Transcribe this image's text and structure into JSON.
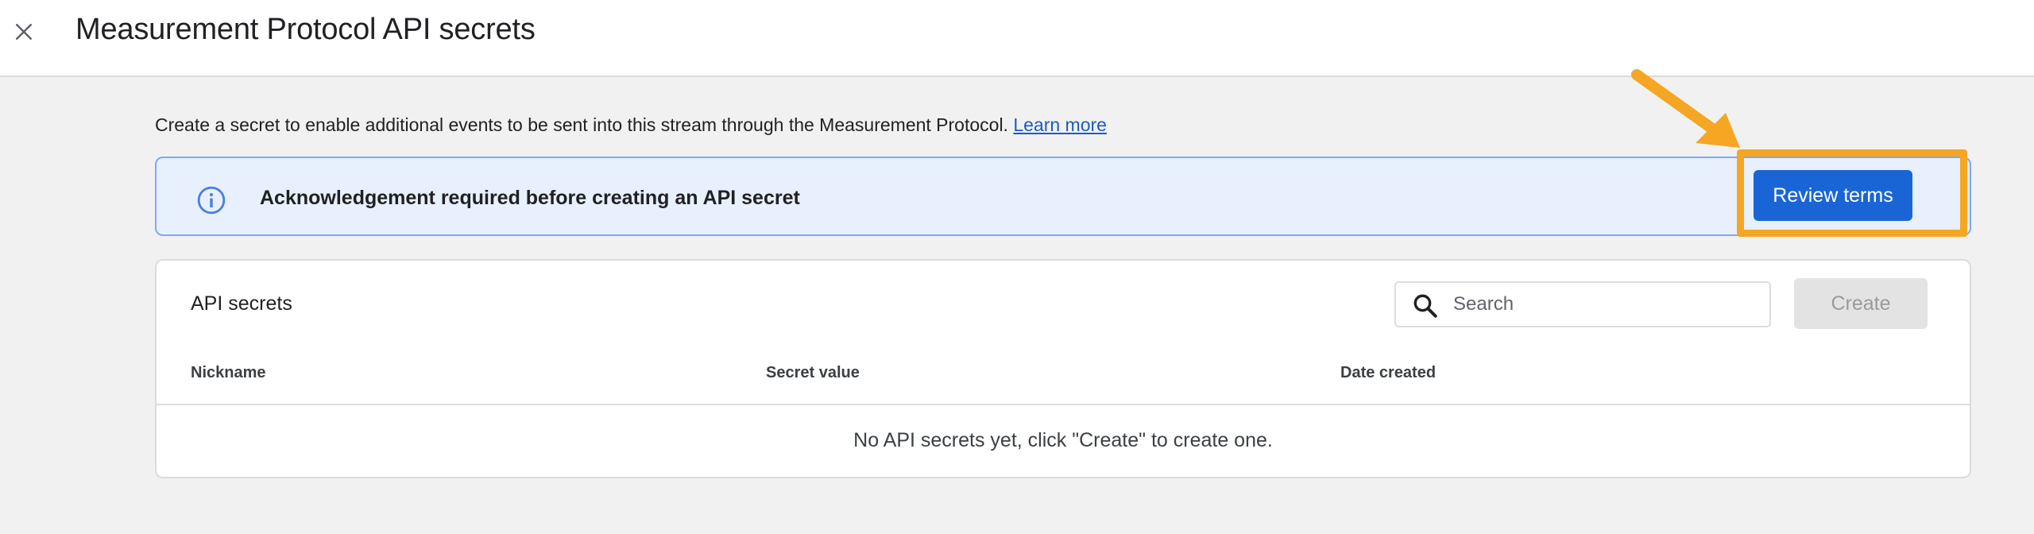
{
  "header": {
    "title": "Measurement Protocol API secrets",
    "close_icon": "close-icon"
  },
  "intro": {
    "text": "Create a secret to enable additional events to be sent into this stream through the Measurement Protocol.",
    "link_label": "Learn more"
  },
  "banner": {
    "icon": "info-icon",
    "message": "Acknowledgement required before creating an API secret",
    "button_label": "Review terms"
  },
  "annotation": {
    "highlight_color": "#f5a623",
    "arrow_icon": "arrow-icon"
  },
  "secrets_card": {
    "title": "API secrets",
    "search": {
      "placeholder": "Search",
      "value": ""
    },
    "create_label": "Create",
    "columns": [
      "Nickname",
      "Secret value",
      "Date created"
    ],
    "empty_message": "No API secrets yet, click \"Create\" to create one."
  },
  "colors": {
    "accent": "#1a65d6",
    "banner_bg": "#e8f0fe",
    "link": "#1a5bc4"
  }
}
